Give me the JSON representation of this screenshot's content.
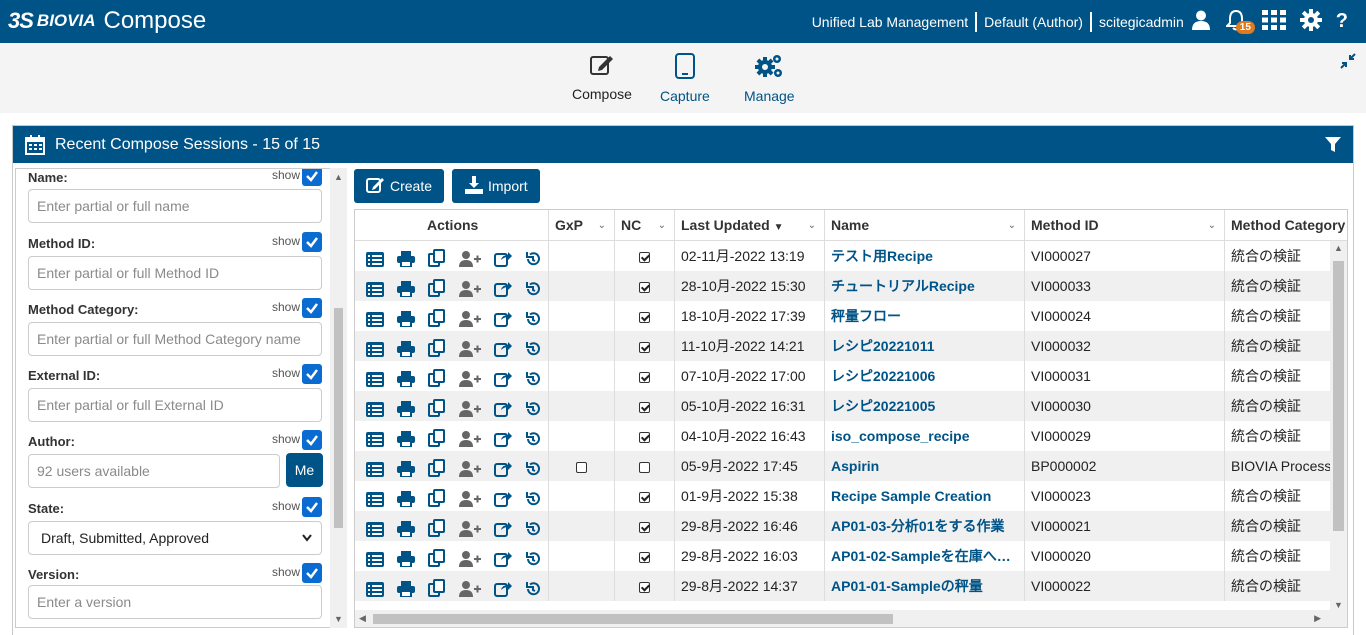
{
  "app": {
    "ds": "3S",
    "brand": "BIOVIA",
    "product": "Compose"
  },
  "topbar": {
    "lab": "Unified Lab Management",
    "role": "Default (Author)",
    "user": "scitegicadmin",
    "notifications": "15"
  },
  "nav": [
    {
      "label": "Compose",
      "icon": "edit-icon"
    },
    {
      "label": "Capture",
      "icon": "tablet-icon"
    },
    {
      "label": "Manage",
      "icon": "gears-icon"
    }
  ],
  "panel": {
    "title": "Recent Compose Sessions - 15 of 15"
  },
  "filters": {
    "show_label": "show",
    "name": {
      "label": "Name:",
      "placeholder": "Enter partial or full name"
    },
    "method_id": {
      "label": "Method ID:",
      "placeholder": "Enter partial or full Method ID"
    },
    "method_category": {
      "label": "Method Category:",
      "placeholder": "Enter partial or full Method Category name"
    },
    "external_id": {
      "label": "External ID:",
      "placeholder": "Enter partial or full External ID"
    },
    "author": {
      "label": "Author:",
      "placeholder": "92 users available",
      "me": "Me"
    },
    "state": {
      "label": "State:",
      "value": "Draft, Submitted, Approved"
    },
    "version": {
      "label": "Version:",
      "placeholder": "Enter a version"
    }
  },
  "toolbar": {
    "create": "Create",
    "import": "Import"
  },
  "columns": {
    "actions": "Actions",
    "gxp": "GxP",
    "nc": "NC",
    "last_updated": "Last Updated",
    "name": "Name",
    "method_id": "Method ID",
    "method_category": "Method Category"
  },
  "rows": [
    {
      "gxp": null,
      "nc": true,
      "updated": "02-11月-2022 13:19",
      "name": "テスト用Recipe",
      "method_id": "VI000027",
      "category": "統合の検証"
    },
    {
      "gxp": null,
      "nc": true,
      "updated": "28-10月-2022 15:30",
      "name": "チュートリアルRecipe",
      "method_id": "VI000033",
      "category": "統合の検証"
    },
    {
      "gxp": null,
      "nc": true,
      "updated": "18-10月-2022 17:39",
      "name": "秤量フロー",
      "method_id": "VI000024",
      "category": "統合の検証"
    },
    {
      "gxp": null,
      "nc": true,
      "updated": "11-10月-2022 14:21",
      "name": "レシピ20221011",
      "method_id": "VI000032",
      "category": "統合の検証"
    },
    {
      "gxp": null,
      "nc": true,
      "updated": "07-10月-2022 17:00",
      "name": "レシピ20221006",
      "method_id": "VI000031",
      "category": "統合の検証"
    },
    {
      "gxp": null,
      "nc": true,
      "updated": "05-10月-2022 16:31",
      "name": "レシピ20221005",
      "method_id": "VI000030",
      "category": "統合の検証"
    },
    {
      "gxp": null,
      "nc": true,
      "updated": "04-10月-2022 16:43",
      "name": "iso_compose_recipe",
      "method_id": "VI000029",
      "category": "統合の検証"
    },
    {
      "gxp": false,
      "nc": false,
      "updated": "05-9月-2022 17:45",
      "name": "Aspirin",
      "method_id": "BP000002",
      "category": "BIOVIA Process"
    },
    {
      "gxp": null,
      "nc": true,
      "updated": "01-9月-2022 15:38",
      "name": "Recipe Sample Creation",
      "method_id": "VI000023",
      "category": "統合の検証"
    },
    {
      "gxp": null,
      "nc": true,
      "updated": "29-8月-2022 16:46",
      "name": "AP01-03-分析01をする作業",
      "method_id": "VI000021",
      "category": "統合の検証"
    },
    {
      "gxp": null,
      "nc": true,
      "updated": "29-8月-2022 16:03",
      "name": "AP01-02-Sampleを在庫へ…",
      "method_id": "VI000020",
      "category": "統合の検証"
    },
    {
      "gxp": null,
      "nc": true,
      "updated": "29-8月-2022 14:37",
      "name": "AP01-01-Sampleの秤量",
      "method_id": "VI000022",
      "category": "統合の検証"
    }
  ],
  "colors": {
    "primary": "#005386",
    "badge": "#e07a1f",
    "checkbox": "#0a6cd0"
  }
}
